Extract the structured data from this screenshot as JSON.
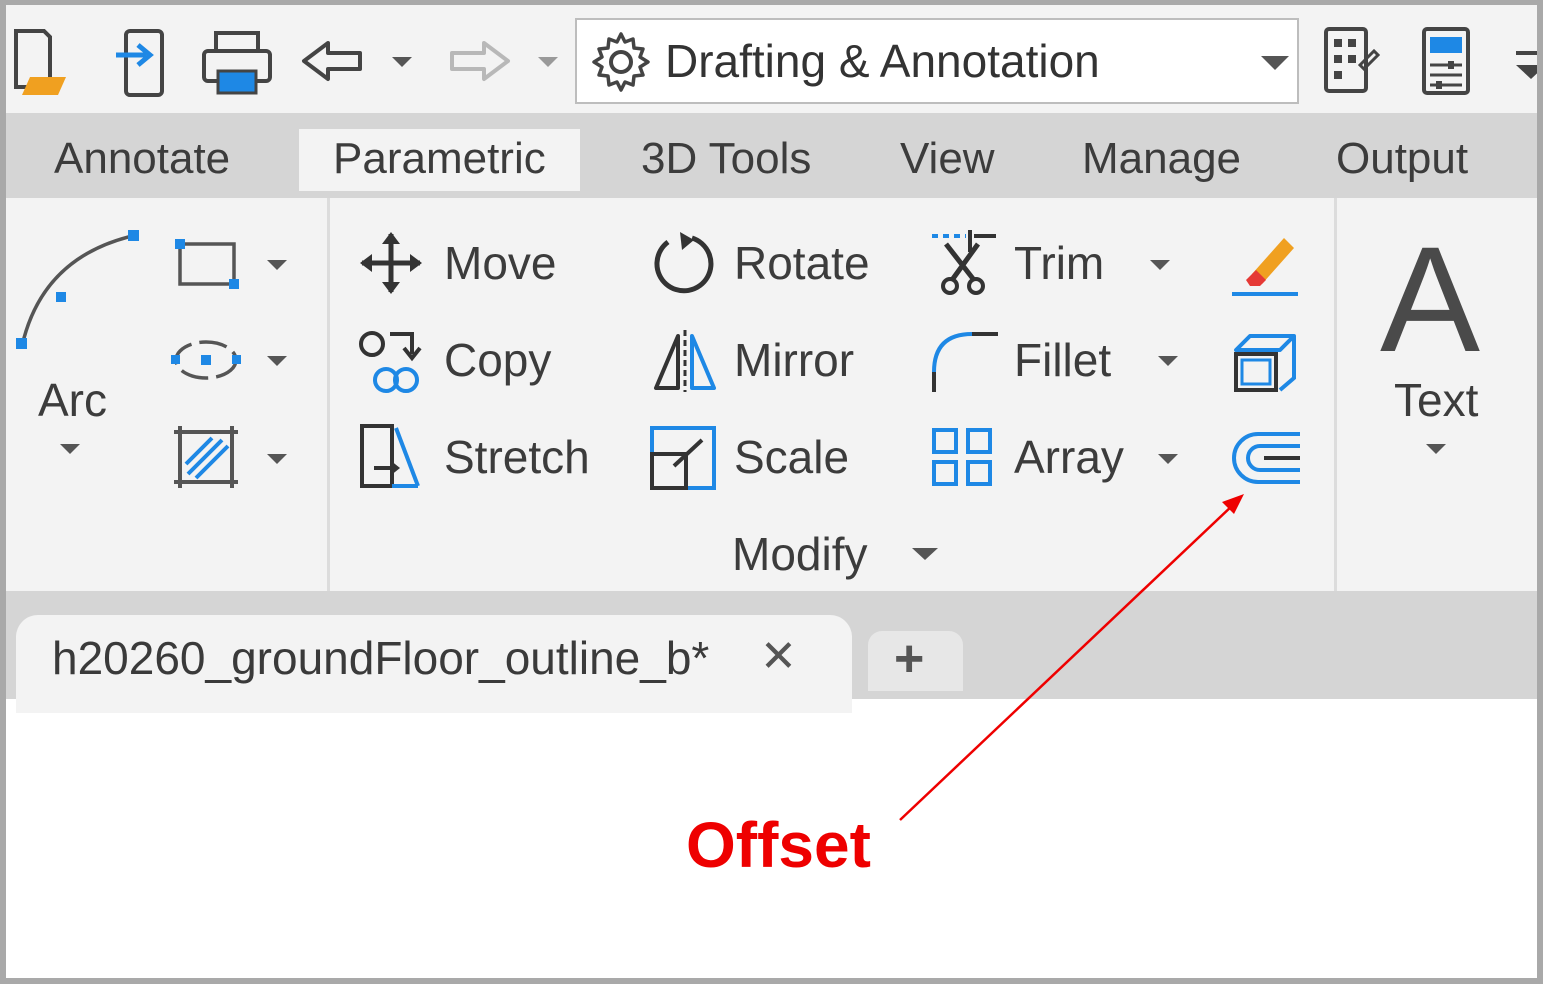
{
  "window": {
    "workspace_selector": {
      "label": "Drafting & Annotation"
    }
  },
  "qat_icons": [
    "new-file-icon",
    "open-file-icon",
    "print-icon",
    "undo-icon",
    "redo-icon",
    "gear-icon",
    "sheet-set-icon",
    "properties-panel-icon"
  ],
  "ribbon_tabs": [
    "Annotate",
    "Parametric",
    "3D Tools",
    "View",
    "Manage",
    "Output"
  ],
  "active_tab": "Parametric",
  "draw_panel": {
    "arc_label": "Arc"
  },
  "modify_panel": {
    "title": "Modify",
    "tools": {
      "move": "Move",
      "rotate": "Rotate",
      "trim": "Trim",
      "copy": "Copy",
      "mirror": "Mirror",
      "fillet": "Fillet",
      "stretch": "Stretch",
      "scale": "Scale",
      "array": "Array"
    }
  },
  "annotation_panel": {
    "text_label": "Text",
    "text_glyph": "A"
  },
  "document_tabs": [
    {
      "label": "h20260_groundFloor_outline_b*",
      "active": true
    }
  ],
  "new_tab_symbol": "+",
  "close_symbol": "✕",
  "callout": {
    "text": "Offset",
    "color": "#ee0000"
  },
  "colors": {
    "accent_blue": "#1e88e5",
    "ribbon_bg": "#f3f3f3",
    "tab_bar_bg": "#d5d5d5"
  }
}
